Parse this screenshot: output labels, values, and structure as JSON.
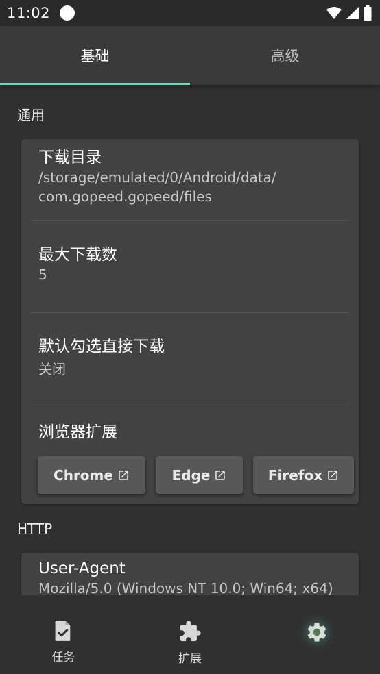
{
  "status_bar": {
    "time": "11:02"
  },
  "tabs": [
    {
      "label": "基础",
      "active": true
    },
    {
      "label": "高级",
      "active": false
    }
  ],
  "general": {
    "title": "通用",
    "download_dir": {
      "label": "下载目录",
      "value_line1": "/storage/emulated/0/Android/data/",
      "value_line2": "com.gopeed.gopeed/files"
    },
    "max_downloads": {
      "label": "最大下载数",
      "value": "5"
    },
    "auto_select": {
      "label": "默认勾选直接下载",
      "value": "关闭"
    },
    "browser_ext": {
      "label": "浏览器扩展",
      "buttons": [
        {
          "label": "Chrome"
        },
        {
          "label": "Edge"
        },
        {
          "label": "Firefox"
        }
      ]
    }
  },
  "http": {
    "title": "HTTP",
    "user_agent": {
      "label": "User-Agent",
      "value": "Mozilla/5.0 (Windows NT 10.0; Win64; x64)"
    }
  },
  "bottom_nav": [
    {
      "label": "任务",
      "icon": "task-check-icon"
    },
    {
      "label": "扩展",
      "icon": "puzzle-icon"
    },
    {
      "label": "",
      "icon": "gear-icon",
      "active": true
    }
  ],
  "colors": {
    "accent": "#6fdcc1",
    "background": "#303030",
    "card": "#424242"
  }
}
